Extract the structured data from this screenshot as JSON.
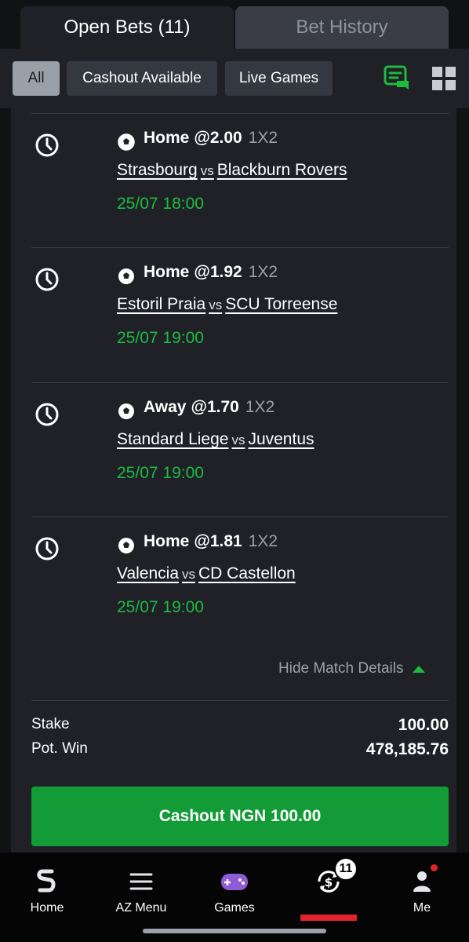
{
  "tabs": [
    {
      "label": "Open Bets (11)",
      "active": true
    },
    {
      "label": "Bet History",
      "active": false
    }
  ],
  "filters": [
    {
      "label": "All",
      "selected": true
    },
    {
      "label": "Cashout Available",
      "selected": false
    },
    {
      "label": "Live Games",
      "selected": false
    }
  ],
  "toolbar_icons": [
    "chat-ticket-icon",
    "grid-view-icon"
  ],
  "bets": [
    {
      "pick": "Home",
      "odds": "@2.00",
      "market": "1X2",
      "home": "Strasbourg",
      "vs": "vs",
      "away": "Blackburn Rovers",
      "time": "25/07 18:00"
    },
    {
      "pick": "Home",
      "odds": "@1.92",
      "market": "1X2",
      "home": "Estoril Praia",
      "vs": "vs",
      "away": "SCU Torreense",
      "time": "25/07 19:00"
    },
    {
      "pick": "Away",
      "odds": "@1.70",
      "market": "1X2",
      "home": "Standard Liege",
      "vs": "vs",
      "away": "Juventus",
      "time": "25/07 19:00"
    },
    {
      "pick": "Home",
      "odds": "@1.81",
      "market": "1X2",
      "home": "Valencia",
      "vs": "vs",
      "away": "CD Castellon",
      "time": "25/07 19:00"
    }
  ],
  "hide_details_label": "Hide Match Details",
  "summary": {
    "stake_label": "Stake",
    "stake_value": "100.00",
    "potwin_label": "Pot. Win",
    "potwin_value": "478,185.76"
  },
  "cashout_button": "Cashout NGN 100.00",
  "nav": [
    {
      "label": "Home",
      "icon": "sporty-logo-icon"
    },
    {
      "label": "AZ Menu",
      "icon": "menu-icon"
    },
    {
      "label": "Games",
      "icon": "gamepad-icon"
    },
    {
      "label": "",
      "icon": "cashout-coin-icon",
      "badge": "11",
      "active": true
    },
    {
      "label": "Me",
      "icon": "user-icon"
    }
  ],
  "colors": {
    "accent_green": "#1dbb3f",
    "button_green": "#129b37",
    "active_red": "#e2232d",
    "panel": "#1f2127",
    "background": "#111214"
  }
}
